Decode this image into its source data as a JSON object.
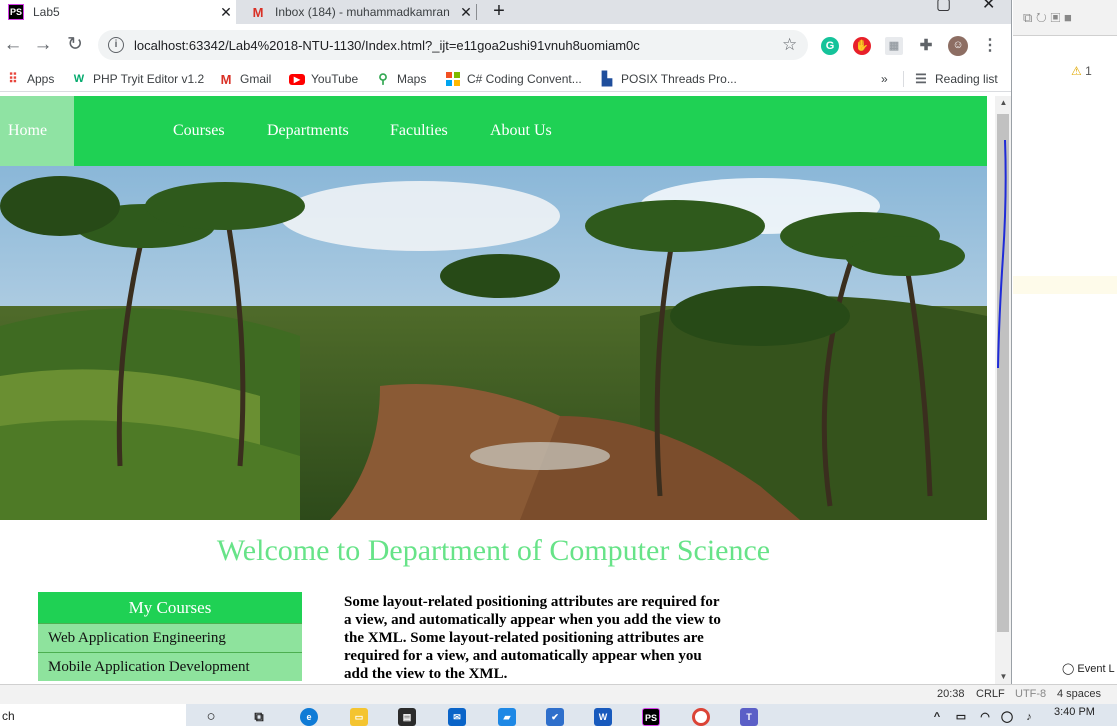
{
  "browser": {
    "tabs": [
      {
        "title": "Lab5",
        "favicon": "phpstorm-icon",
        "active": true
      },
      {
        "title": "Inbox (184) - muhammadkamran",
        "favicon": "gmail-icon",
        "active": false
      }
    ],
    "new_tab": "+",
    "url": "localhost:63342/Lab4%2018-NTU-1130/Index.html?_ijt=e11goa2ushi91vnuh8uomiam0c",
    "bookmarks": [
      {
        "label": "Apps",
        "icon": "apps-grid-icon"
      },
      {
        "label": "PHP Tryit Editor v1.2",
        "icon": "w3schools-icon"
      },
      {
        "label": "Gmail",
        "icon": "gmail-icon"
      },
      {
        "label": "YouTube",
        "icon": "youtube-icon"
      },
      {
        "label": "Maps",
        "icon": "maps-pin-icon"
      },
      {
        "label": "C# Coding Convent...",
        "icon": "microsoft-icon"
      },
      {
        "label": "POSIX Threads Pro...",
        "icon": "llnl-icon"
      }
    ],
    "more_bookmarks": "»",
    "reading_list": "Reading list"
  },
  "site": {
    "nav": [
      "Home",
      "Courses",
      "Departments",
      "Faculties",
      "About Us"
    ],
    "welcome": "Welcome to Department of Computer Science",
    "courses_title": "My Courses",
    "courses": [
      "Web Application Engineering",
      "Mobile Application Development"
    ],
    "paragraph": "Some layout-related positioning attributes are required for a view, and automatically appear when you add the view to the XML. Some layout-related positioning attributes are required for a view, and automatically appear when you add the view to the XML."
  },
  "ide": {
    "warnings": "1",
    "event_log": "Event L",
    "status": {
      "position": "20:38",
      "line_sep": "CRLF",
      "encoding": "UTF-8",
      "indent": "4 spaces"
    }
  },
  "taskbar": {
    "search_text": "ch",
    "time": "3:40 PM"
  },
  "colors": {
    "nav_green": "#1fd154",
    "home_active": "#8fe3a3",
    "welcome": "#67e388",
    "course_item": "#8ee39d"
  }
}
